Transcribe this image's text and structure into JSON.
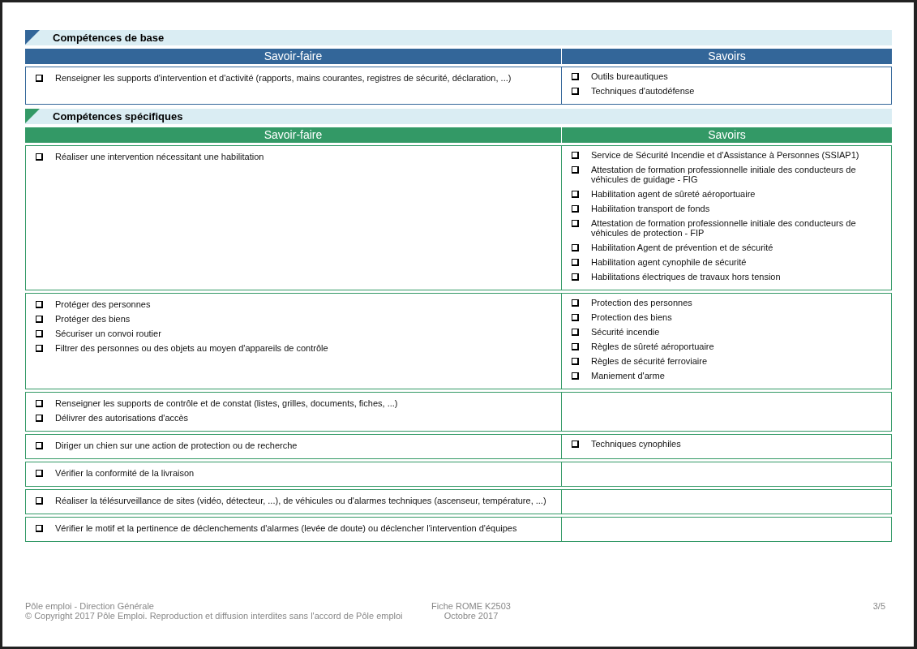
{
  "sections": [
    {
      "title": "Compétences de base",
      "color": "#336699",
      "columns": [
        "Savoir-faire",
        "Savoirs"
      ],
      "rows": [
        {
          "savoir_faire": [
            "Renseigner les supports d'intervention et d'activité (rapports, mains courantes, registres de sécurité, déclaration, ...)"
          ],
          "savoirs": [
            "Outils bureautiques",
            "Techniques d'autodéfense"
          ]
        }
      ]
    },
    {
      "title": "Compétences spécifiques",
      "color": "#339966",
      "columns": [
        "Savoir-faire",
        "Savoirs"
      ],
      "rows": [
        {
          "savoir_faire": [
            "Réaliser une intervention nécessitant une habilitation"
          ],
          "savoirs": [
            "Service de Sécurité Incendie et d'Assistance à Personnes (SSIAP1)",
            "Attestation de formation professionnelle initiale des conducteurs de véhicules de guidage - FIG",
            "Habilitation agent de sûreté aéroportuaire",
            "Habilitation transport de fonds",
            "Attestation de formation professionnelle initiale des conducteurs de véhicules de protection - FIP",
            "Habilitation Agent de prévention et de sécurité",
            "Habilitation agent cynophile de sécurité",
            "Habilitations électriques de travaux hors tension"
          ]
        },
        {
          "savoir_faire": [
            "Protéger des personnes",
            "Protéger des biens",
            "Sécuriser un convoi routier",
            "Filtrer des personnes ou des objets au moyen d'appareils de contrôle"
          ],
          "savoirs": [
            "Protection des personnes",
            "Protection des biens",
            "Sécurité incendie",
            "Règles de sûreté aéroportuaire",
            "Règles de sécurité ferroviaire",
            "Maniement d'arme"
          ]
        },
        {
          "savoir_faire": [
            "Renseigner les supports de contrôle et de constat (listes, grilles, documents, fiches, ...)",
            "Délivrer des autorisations d'accès"
          ],
          "savoirs": []
        },
        {
          "savoir_faire": [
            "Diriger un chien sur une action de protection ou de recherche"
          ],
          "savoirs": [
            "Techniques cynophiles"
          ]
        },
        {
          "savoir_faire": [
            "Vérifier la conformité de la livraison"
          ],
          "savoirs": []
        },
        {
          "savoir_faire": [
            "Réaliser la télésurveillance de sites (vidéo, détecteur, ...), de véhicules ou d'alarmes techniques (ascenseur, température, ...)"
          ],
          "savoirs": []
        },
        {
          "savoir_faire": [
            "Vérifier le motif et la pertinence de déclenchements d'alarmes (levée de doute) ou déclencher l'intervention d'équipes"
          ],
          "savoirs": []
        }
      ]
    }
  ],
  "footer": {
    "left": [
      "Pôle emploi - Direction Générale",
      "© Copyright 2017 Pôle Emploi. Reproduction et diffusion interdites sans l'accord de Pôle emploi"
    ],
    "center": [
      "Fiche ROME K2503",
      "Octobre 2017"
    ],
    "page": "3/5"
  }
}
